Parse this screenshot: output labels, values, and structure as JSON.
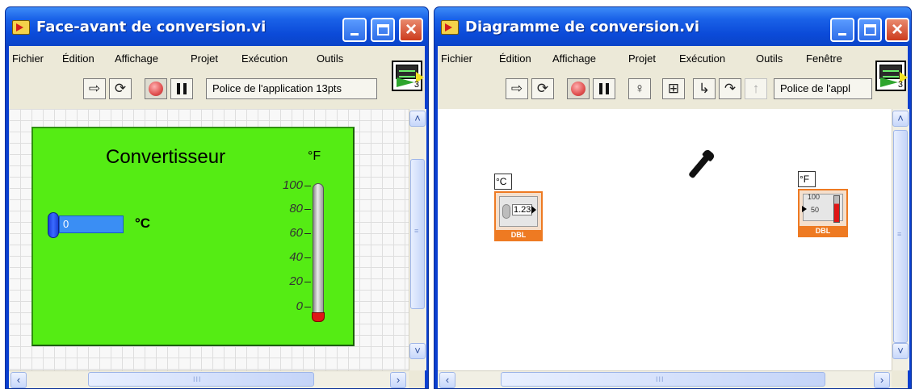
{
  "front_panel_window": {
    "title": "Face-avant de conversion.vi",
    "menu": [
      "Fichier",
      "Édition",
      "Affichage",
      "Projet",
      "Exécution",
      "Outils"
    ],
    "font_selector": "Police de l'application 13pts",
    "vi_icon_number": "3",
    "panel": {
      "title": "Convertisseur",
      "unit_fahrenheit": "°F",
      "unit_celsius": "°C",
      "numeric_value": "0",
      "scale": [
        "100",
        "80",
        "60",
        "40",
        "20",
        "0"
      ],
      "thermometer_level": 0.0,
      "panel_color": "#55ec14"
    },
    "scroll_grip": "III"
  },
  "diagram_window": {
    "title": "Diagramme de conversion.vi",
    "menu": [
      "Fichier",
      "Édition",
      "Affichage",
      "Projet",
      "Exécution",
      "Outils",
      "Fenêtre"
    ],
    "font_selector": "Police de l'appl",
    "vi_icon_number": "3",
    "celsius_terminal": {
      "label": "°C",
      "value": "1.23",
      "type": "DBL"
    },
    "fahrenheit_terminal": {
      "label": "°F",
      "top_tick": "100",
      "mid_tick": "50",
      "type": "DBL"
    },
    "scroll_grip": "III"
  },
  "colors": {
    "title_bar": "#0b4ad8",
    "terminal_border": "#ee7a22",
    "close_button": "#cc3b1d"
  }
}
